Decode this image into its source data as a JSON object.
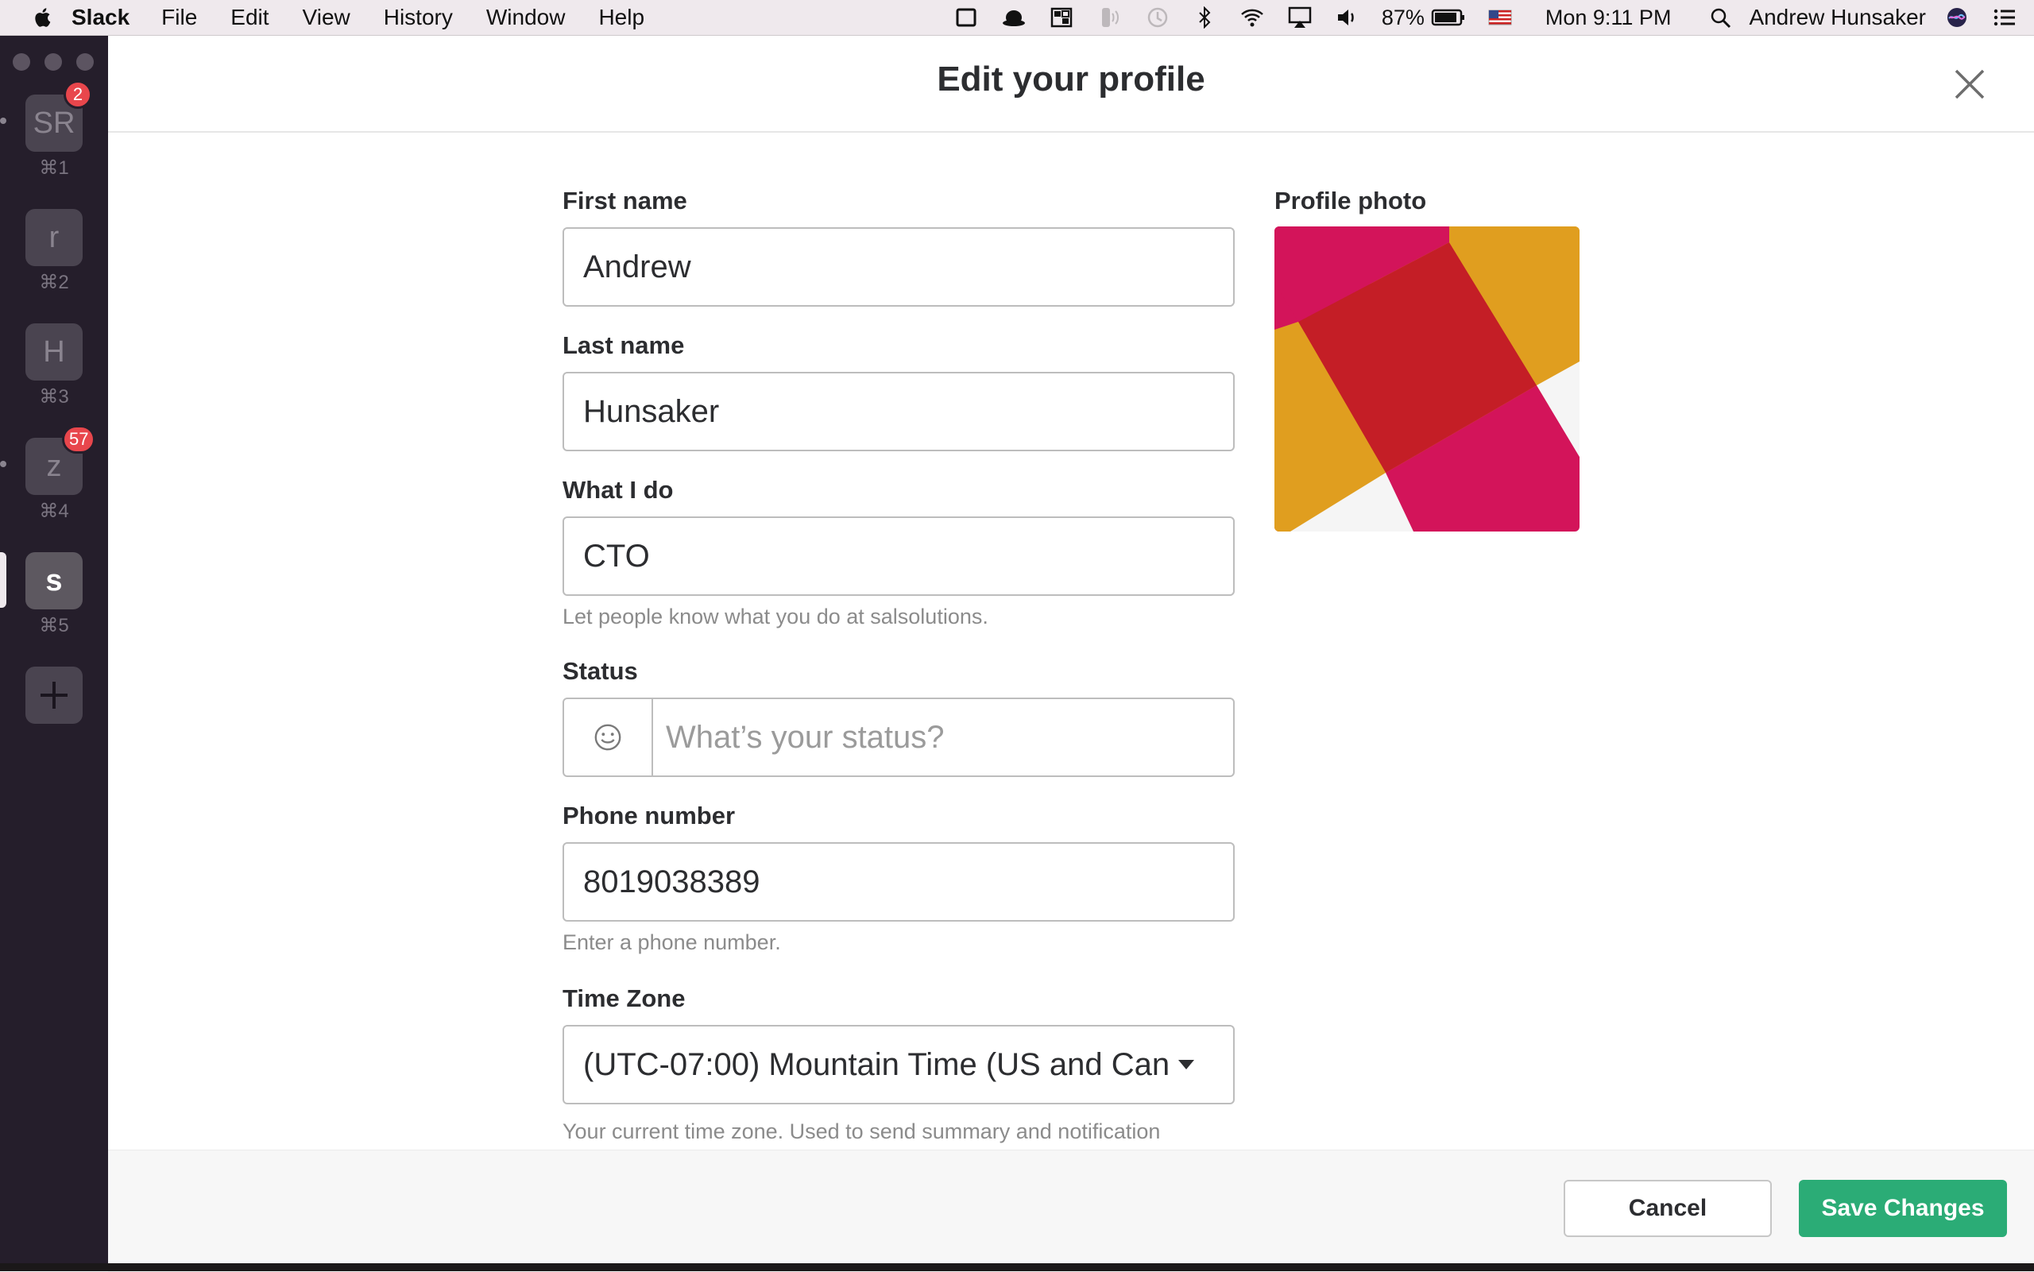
{
  "menubar": {
    "app_name": "Slack",
    "menus": [
      "File",
      "Edit",
      "View",
      "History",
      "Window",
      "Help"
    ],
    "battery": "87%",
    "clock": "Mon 9:11 PM",
    "user": "Andrew Hunsaker",
    "icons": [
      "apple-icon",
      "screen-icon",
      "bowler-hat-icon",
      "grid-app-icon",
      "audio-icon",
      "time-machine-icon",
      "bluetooth-icon",
      "wifi-icon",
      "airplay-icon",
      "volume-icon",
      "battery-icon",
      "us-flag-icon",
      "spotlight-icon",
      "siri-icon",
      "notification-center-icon"
    ]
  },
  "workspaces": [
    {
      "initials": "SR",
      "shortcut": "⌘1",
      "badge": "2"
    },
    {
      "initials": "r",
      "shortcut": "⌘2",
      "badge": ""
    },
    {
      "initials": "H",
      "shortcut": "⌘3",
      "badge": ""
    },
    {
      "initials": "z",
      "shortcut": "⌘4",
      "badge": "57"
    },
    {
      "initials": "s",
      "shortcut": "⌘5",
      "badge": "",
      "active": true
    }
  ],
  "modal": {
    "title": "Edit your profile",
    "first_name": {
      "label": "First name",
      "value": "Andrew"
    },
    "last_name": {
      "label": "Last name",
      "value": "Hunsaker"
    },
    "what_i_do": {
      "label": "What I do",
      "value": "CTO",
      "hint": "Let people know what you do at salsolutions."
    },
    "status": {
      "label": "Status",
      "placeholder": "What’s your status?"
    },
    "phone": {
      "label": "Phone number",
      "value": "8019038389",
      "hint": "Enter a phone number."
    },
    "timezone": {
      "label": "Time Zone",
      "value": "(UTC-07:00) Mountain Time (US and Can",
      "hint": "Your current time zone. Used to send summary and notification"
    },
    "photo_label": "Profile photo",
    "cancel": "Cancel",
    "save": "Save Changes"
  },
  "colors": {
    "sidebar_bg": "#251e2b",
    "save_green": "#2bac76",
    "badge_red": "#e8464c",
    "photo_magenta": "#d3145a",
    "photo_orange": "#e09e1f",
    "photo_red": "#c41e26"
  }
}
